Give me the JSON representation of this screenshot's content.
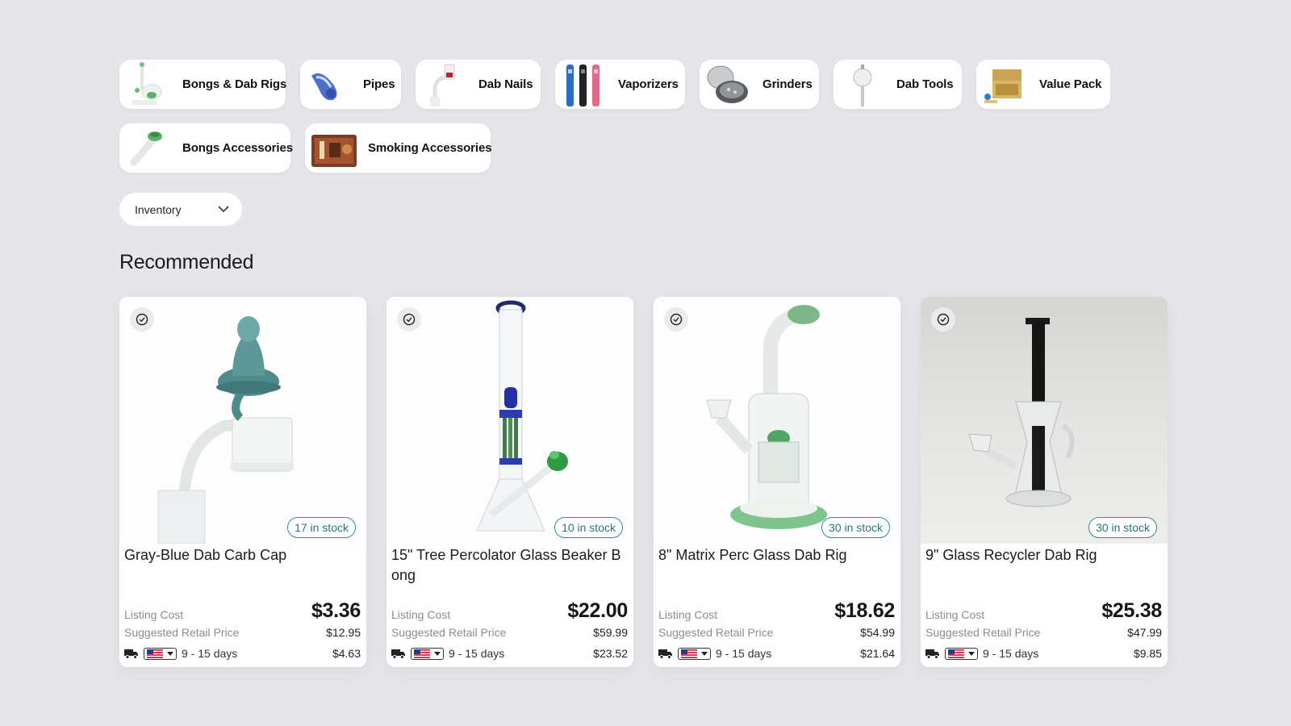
{
  "categories": [
    {
      "label": "Bongs & Dab Rigs",
      "icon": "bong-rig-icon"
    },
    {
      "label": "Pipes",
      "icon": "pipe-icon"
    },
    {
      "label": "Dab Nails",
      "icon": "dab-nail-icon"
    },
    {
      "label": "Vaporizers",
      "icon": "vaporizer-icon"
    },
    {
      "label": "Grinders",
      "icon": "grinder-icon"
    },
    {
      "label": "Dab Tools",
      "icon": "dab-tool-icon"
    },
    {
      "label": "Value Pack",
      "icon": "value-pack-icon"
    },
    {
      "label": "Bongs Accessories",
      "icon": "bong-accessory-icon"
    },
    {
      "label": "Smoking Accessories",
      "icon": "smoking-accessory-icon"
    }
  ],
  "filter": {
    "label": "Inventory",
    "icon": "chevron-down-icon"
  },
  "section_title": "Recommended",
  "labels": {
    "listing_cost": "Listing Cost",
    "suggested_retail": "Suggested Retail Price",
    "shipping_days": "9 - 15 days"
  },
  "products": [
    {
      "name": "Gray-Blue Dab Carb Cap",
      "stock": "17 in stock",
      "listing_cost": "$3.36",
      "suggested_retail": "$12.95",
      "shipping_cost": "$4.63"
    },
    {
      "name": "15\" Tree Percolator Glass Beaker Bong",
      "stock": "10 in stock",
      "listing_cost": "$22.00",
      "suggested_retail": "$59.99",
      "shipping_cost": "$23.52"
    },
    {
      "name": "8\" Matrix Perc Glass Dab Rig",
      "stock": "30 in stock",
      "listing_cost": "$18.62",
      "suggested_retail": "$54.99",
      "shipping_cost": "$21.64"
    },
    {
      "name": "9\" Glass Recycler Dab Rig",
      "stock": "30 in stock",
      "listing_cost": "$25.38",
      "suggested_retail": "$47.99",
      "shipping_cost": "$9.85"
    }
  ],
  "colors": {
    "stock_badge": "#2d8f91",
    "background": "#e6e6ea"
  }
}
